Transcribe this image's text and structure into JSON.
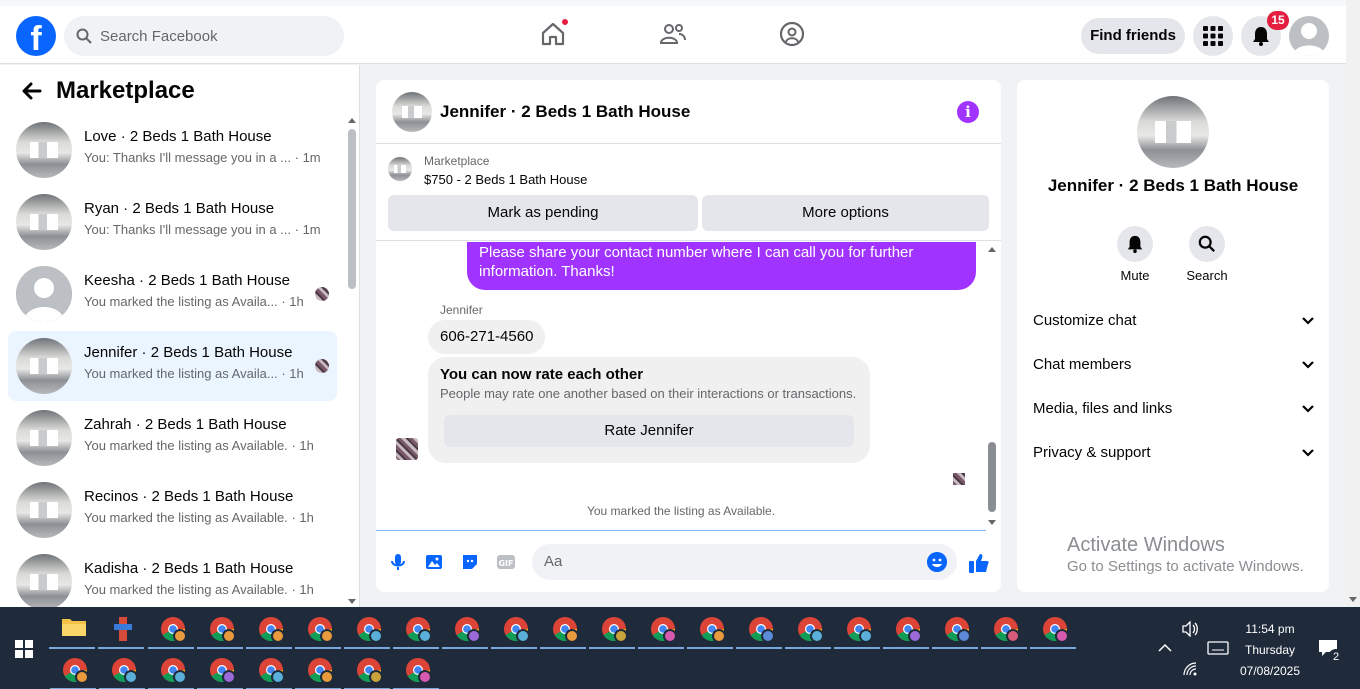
{
  "header": {
    "search_placeholder": "Search Facebook",
    "find_friends": "Find friends",
    "notification_count": "15"
  },
  "sidebar": {
    "title": "Marketplace",
    "conversations": [
      {
        "title": "Love · 2 Beds 1 Bath House",
        "snippet": "You: Thanks I'll message you in a ...",
        "time": "· 1m",
        "active": false
      },
      {
        "title": "Ryan · 2 Beds 1 Bath House",
        "snippet": "You: Thanks I'll message you in a ...",
        "time": "· 1m",
        "active": false
      },
      {
        "title": "Keesha · 2 Beds 1 Bath House",
        "snippet": "You marked the listing as Availa...",
        "time": "· 1h",
        "active": false
      },
      {
        "title": "Jennifer · 2 Beds 1 Bath House",
        "snippet": "You marked the listing as Availa...",
        "time": "· 1h",
        "active": true
      },
      {
        "title": "Zahrah · 2 Beds 1 Bath House",
        "snippet": "You marked the listing as Available.",
        "time": "· 1h",
        "active": false
      },
      {
        "title": "Recinos · 2 Beds 1 Bath House",
        "snippet": "You marked the listing as Available.",
        "time": "· 1h",
        "active": false
      },
      {
        "title": "Kadisha · 2 Beds 1 Bath House",
        "snippet": "You marked the listing as Available.",
        "time": "· 1h",
        "active": false
      }
    ]
  },
  "chat": {
    "title": "Jennifer · 2 Beds 1 Bath House",
    "listing_category": "Marketplace",
    "listing_name": "$750 - 2 Beds 1 Bath House",
    "mark_pending": "Mark as pending",
    "more_options": "More options",
    "outgoing_message": "Please share your contact number where I can call you for further information. Thanks!",
    "sender_name": "Jennifer",
    "incoming_message": "606-271-4560",
    "rate_title": "You can now rate each other",
    "rate_subtitle": "People may rate one another based on their interactions or transactions.",
    "rate_button": "Rate Jennifer",
    "system_message": "You marked the listing as Available.",
    "composer_placeholder": "Aa"
  },
  "details": {
    "name": "Jennifer · 2 Beds 1 Bath House",
    "mute_label": "Mute",
    "search_label": "Search",
    "sections": [
      "Customize chat",
      "Chat members",
      "Media, files and links",
      "Privacy & support"
    ]
  },
  "watermark": {
    "line1": "Activate Windows",
    "line2": "Go to Settings to activate Windows."
  },
  "taskbar": {
    "time": "11:54 pm",
    "day": "Thursday",
    "date": "07/08/2025",
    "notification_count": "2"
  },
  "colors": {
    "brand": "#0866ff",
    "accent_purple": "#a033ff",
    "alert_red": "#e41e3f"
  }
}
